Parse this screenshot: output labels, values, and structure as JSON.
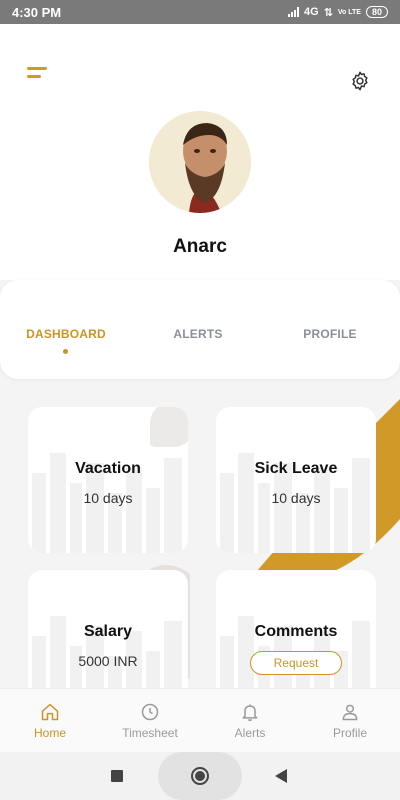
{
  "status_bar": {
    "time": "4:30 PM",
    "network": "4G",
    "volte": "Vo LTE",
    "battery": "80"
  },
  "header": {
    "username": "Anarc"
  },
  "tabs": [
    {
      "label": "DASHBOARD",
      "active": true
    },
    {
      "label": "ALERTS",
      "active": false
    },
    {
      "label": "PROFILE",
      "active": false
    }
  ],
  "cards": [
    {
      "title": "Vacation",
      "value": "10 days"
    },
    {
      "title": "Sick Leave",
      "value": "10 days"
    },
    {
      "title": "Salary",
      "value": "5000 INR"
    },
    {
      "title": "Comments",
      "action": "Request"
    }
  ],
  "bottom_nav": [
    {
      "label": "Home",
      "icon": "home-icon",
      "active": true
    },
    {
      "label": "Timesheet",
      "icon": "clock-icon",
      "active": false
    },
    {
      "label": "Alerts",
      "icon": "bell-icon",
      "active": false
    },
    {
      "label": "Profile",
      "icon": "user-icon",
      "active": false
    }
  ],
  "colors": {
    "accent": "#c99526",
    "muted": "#9a9a9a",
    "background": "#f4f4f4"
  }
}
